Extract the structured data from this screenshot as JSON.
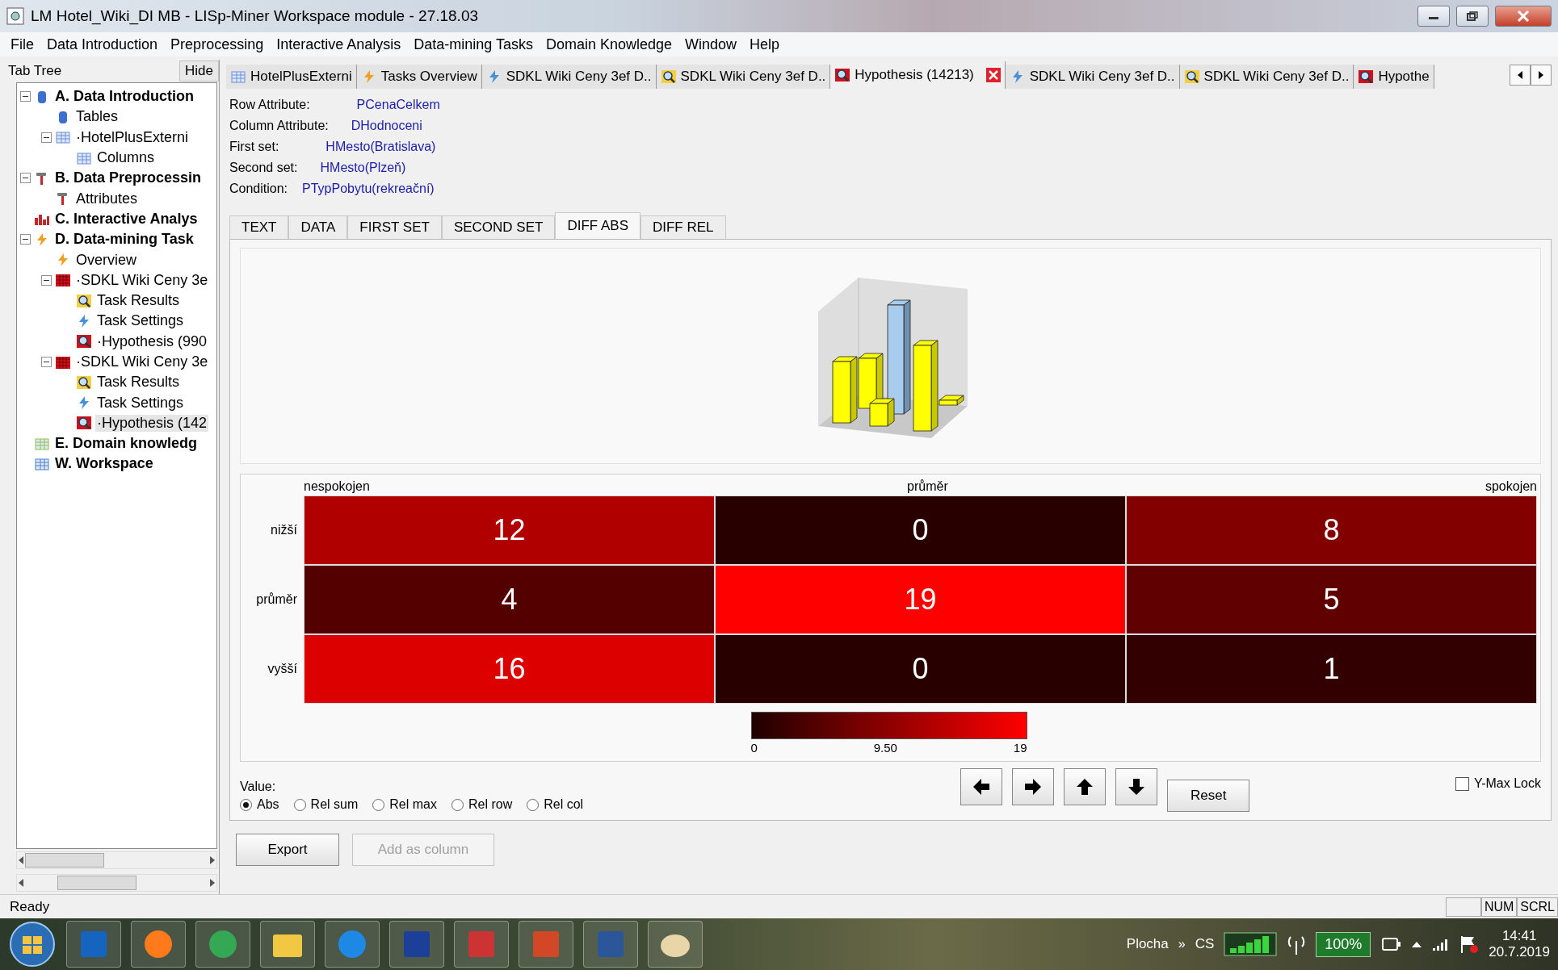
{
  "window": {
    "title": "LM Hotel_Wiki_DI MB - LISp-Miner Workspace module - 27.18.03"
  },
  "menu": [
    "File",
    "Data Introduction",
    "Preprocessing",
    "Interactive Analysis",
    "Data-mining Tasks",
    "Domain Knowledge",
    "Window",
    "Help"
  ],
  "tab_tree": {
    "title": "Tab Tree",
    "hide_button": "Hide",
    "items": [
      {
        "label": "A. Data Introduction",
        "kind": "database",
        "expanded": true,
        "selected": false,
        "children": [
          {
            "label": "Tables",
            "kind": "tables",
            "selected": false
          },
          {
            "label": "·HotelPlusExterni",
            "kind": "table",
            "expanded": true,
            "selected": false,
            "children": [
              {
                "label": "Columns",
                "kind": "columns",
                "selected": false
              }
            ]
          }
        ]
      },
      {
        "label": "B. Data Preprocessin",
        "kind": "hammer",
        "expanded": true,
        "selected": false,
        "children": [
          {
            "label": "Attributes",
            "kind": "attributes",
            "selected": false
          }
        ]
      },
      {
        "label": "C. Interactive Analys",
        "kind": "bars",
        "selected": false
      },
      {
        "label": "D. Data-mining Task",
        "kind": "bolt",
        "expanded": true,
        "selected": false,
        "children": [
          {
            "label": "Overview",
            "kind": "overview",
            "selected": false
          },
          {
            "label": "·SDKL Wiki Ceny 3e",
            "kind": "task",
            "expanded": true,
            "selected": false,
            "children": [
              {
                "label": "Task Results",
                "kind": "results",
                "selected": false
              },
              {
                "label": "Task Settings",
                "kind": "settings",
                "selected": false
              },
              {
                "label": "·Hypothesis (990",
                "kind": "hypothesis",
                "selected": false
              }
            ]
          },
          {
            "label": "·SDKL Wiki Ceny 3e",
            "kind": "task",
            "expanded": true,
            "selected": false,
            "children": [
              {
                "label": "Task Results",
                "kind": "results",
                "selected": false
              },
              {
                "label": "Task Settings",
                "kind": "settings",
                "selected": false
              },
              {
                "label": "·Hypothesis (142",
                "kind": "hypothesis",
                "selected": true
              }
            ]
          }
        ]
      },
      {
        "label": "E. Domain knowledg",
        "kind": "knowledge",
        "selected": false
      },
      {
        "label": "W. Workspace",
        "kind": "workspace",
        "selected": false
      }
    ]
  },
  "doc_tabs": [
    {
      "label": "HotelPlusExterni",
      "kind": "columns",
      "selected": false
    },
    {
      "label": "Tasks Overview",
      "kind": "overview",
      "selected": false
    },
    {
      "label": "SDKL Wiki Ceny 3ef D..",
      "kind": "settings",
      "selected": false
    },
    {
      "label": "SDKL Wiki Ceny 3ef D..",
      "kind": "results",
      "selected": false
    },
    {
      "label": "Hypothesis (14213)",
      "kind": "hypothesis",
      "selected": true
    },
    {
      "label": "SDKL Wiki Ceny 3ef D..",
      "kind": "settings",
      "selected": false
    },
    {
      "label": "SDKL Wiki Ceny 3ef D..",
      "kind": "results",
      "selected": false
    },
    {
      "label": "Hypothe",
      "kind": "hypothesis",
      "selected": false
    }
  ],
  "info": [
    {
      "label": "Row Attribute:",
      "value": "PCenaCelkem"
    },
    {
      "label": "Column Attribute:",
      "value": "DHodnoceni"
    },
    {
      "label": "First set:",
      "value": "HMesto(Bratislava)"
    },
    {
      "label": "Second set:",
      "value": "HMesto(Plzeň)"
    },
    {
      "label": "Condition:",
      "value": "PTypPobytu(rekreační)"
    }
  ],
  "view_tabs": [
    {
      "label": "TEXT",
      "selected": false
    },
    {
      "label": "DATA",
      "selected": false
    },
    {
      "label": "FIRST SET",
      "selected": false
    },
    {
      "label": "SECOND SET",
      "selected": false
    },
    {
      "label": "DIFF ABS",
      "selected": true
    },
    {
      "label": "DIFF REL",
      "selected": false
    }
  ],
  "heatmap": {
    "columns": [
      "nespokojen",
      "průměr",
      "spokojen"
    ],
    "rows": [
      {
        "label": "nižší",
        "values": [
          "12",
          "0",
          "8"
        ]
      },
      {
        "label": "průměr",
        "values": [
          "4",
          "19",
          "5"
        ]
      },
      {
        "label": "vyšší",
        "values": [
          "16",
          "0",
          "1"
        ]
      }
    ],
    "legend": {
      "min": "0",
      "mid": "9.50",
      "max": "19"
    }
  },
  "value_options": {
    "label": "Value:",
    "options": [
      {
        "label": "Abs",
        "selected": true
      },
      {
        "label": "Rel sum",
        "selected": false
      },
      {
        "label": "Rel max",
        "selected": false
      },
      {
        "label": "Rel row",
        "selected": false
      },
      {
        "label": "Rel col",
        "selected": false
      }
    ]
  },
  "reset_button": "Reset",
  "y_max_lock": {
    "label": "Y-Max Lock",
    "checked": false
  },
  "buttons": [
    {
      "label": "Export",
      "disabled": false
    },
    {
      "label": "Add as column",
      "disabled": true
    }
  ],
  "status_bar": {
    "text": "Ready",
    "indicators": [
      "NUM",
      "SCRL"
    ]
  },
  "taskbar": {
    "toolbar": "Plocha",
    "chevron": "»",
    "language": "CS",
    "battery": "100%",
    "time": "14:41",
    "date": "20.7.2019"
  }
}
